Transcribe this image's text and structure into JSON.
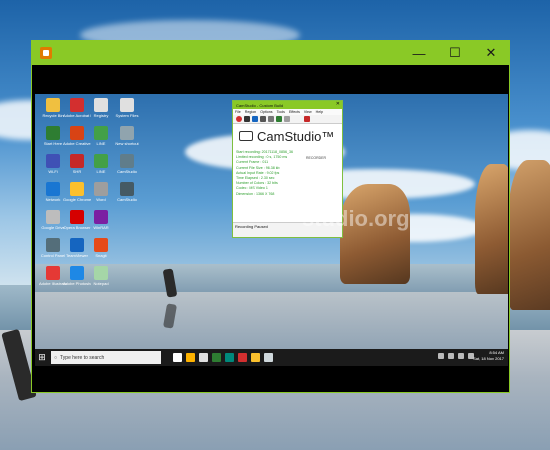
{
  "window": {
    "title": "",
    "controls": {
      "minimize": "—",
      "maximize": "☐",
      "close": "✕"
    }
  },
  "desktop_icons": [
    {
      "label": "Recycle Bin",
      "color": "#f0c040"
    },
    {
      "label": "Adobe Acrobat DC",
      "color": "#d32f2f"
    },
    {
      "label": "Registry",
      "color": "#e0e0e0"
    },
    {
      "label": "System Files",
      "color": "#e0e0e0"
    },
    {
      "label": "Start Here",
      "color": "#2e7d32"
    },
    {
      "label": "Adobe Creative Cloud",
      "color": "#d84315"
    },
    {
      "label": "LINE",
      "color": "#43a047"
    },
    {
      "label": "New shortcut",
      "color": "#90a4ae"
    },
    {
      "label": "Wi-Fi",
      "color": "#3f51b5"
    },
    {
      "label": "SHR",
      "color": "#c62828"
    },
    {
      "label": "LINE",
      "color": "#43a047"
    },
    {
      "label": "CamStudio",
      "color": "#607d8b"
    },
    {
      "label": "Network",
      "color": "#1976d2"
    },
    {
      "label": "Google Chrome",
      "color": "#fbc02d"
    },
    {
      "label": "Word",
      "color": "#9e9e9e"
    },
    {
      "label": "CamStudio",
      "color": "#455a64"
    },
    {
      "label": "Google Drive",
      "color": "#bdbdbd"
    },
    {
      "label": "Opera Browser",
      "color": "#d50000"
    },
    {
      "label": "WinRAR",
      "color": "#7b1fa2"
    },
    {
      "label": "Control Panel",
      "color": "#546e7a"
    },
    {
      "label": "TeamViewer",
      "color": "#1565c0"
    },
    {
      "label": "Snagit",
      "color": "#e64a19"
    },
    {
      "label": "Adobe Illustrator",
      "color": "#e53935"
    },
    {
      "label": "Adobe Photoshop",
      "color": "#1e88e5"
    },
    {
      "label": "Notepad",
      "color": "#a5d6a7"
    }
  ],
  "taskbar": {
    "search_placeholder": "Type here to search",
    "time": "8:54 AM",
    "date": "Sat, 18 Nov 2017",
    "app_colors": [
      "#ffffff",
      "#ffb300",
      "#e0e0e0",
      "#2e7d32",
      "#00897b",
      "#d32f2f",
      "#fbc02d",
      "#cfd8dc"
    ]
  },
  "camstudio": {
    "title": "CamStudio - Custom Build",
    "menu": [
      "File",
      "Region",
      "Options",
      "Tools",
      "Effects",
      "View",
      "Help"
    ],
    "logo_name": "CamStudio™",
    "logo_sub": "RECORDER",
    "info_lines": [
      "Start recording: 20171118_0856_36",
      "Limited recording : 0 s, 1750 ms",
      "Current Frame : 011",
      "Current File Size : 96.38 kb",
      "Actual Input Rate : 9.02 fps",
      "Time Elapsed : 2.30 sec",
      "Number of Colors : 32 bits",
      "Codec : MS Video 1",
      "Dimension : 1366 X 768"
    ],
    "status": "Recording Paused",
    "watermark": "studio.org"
  }
}
